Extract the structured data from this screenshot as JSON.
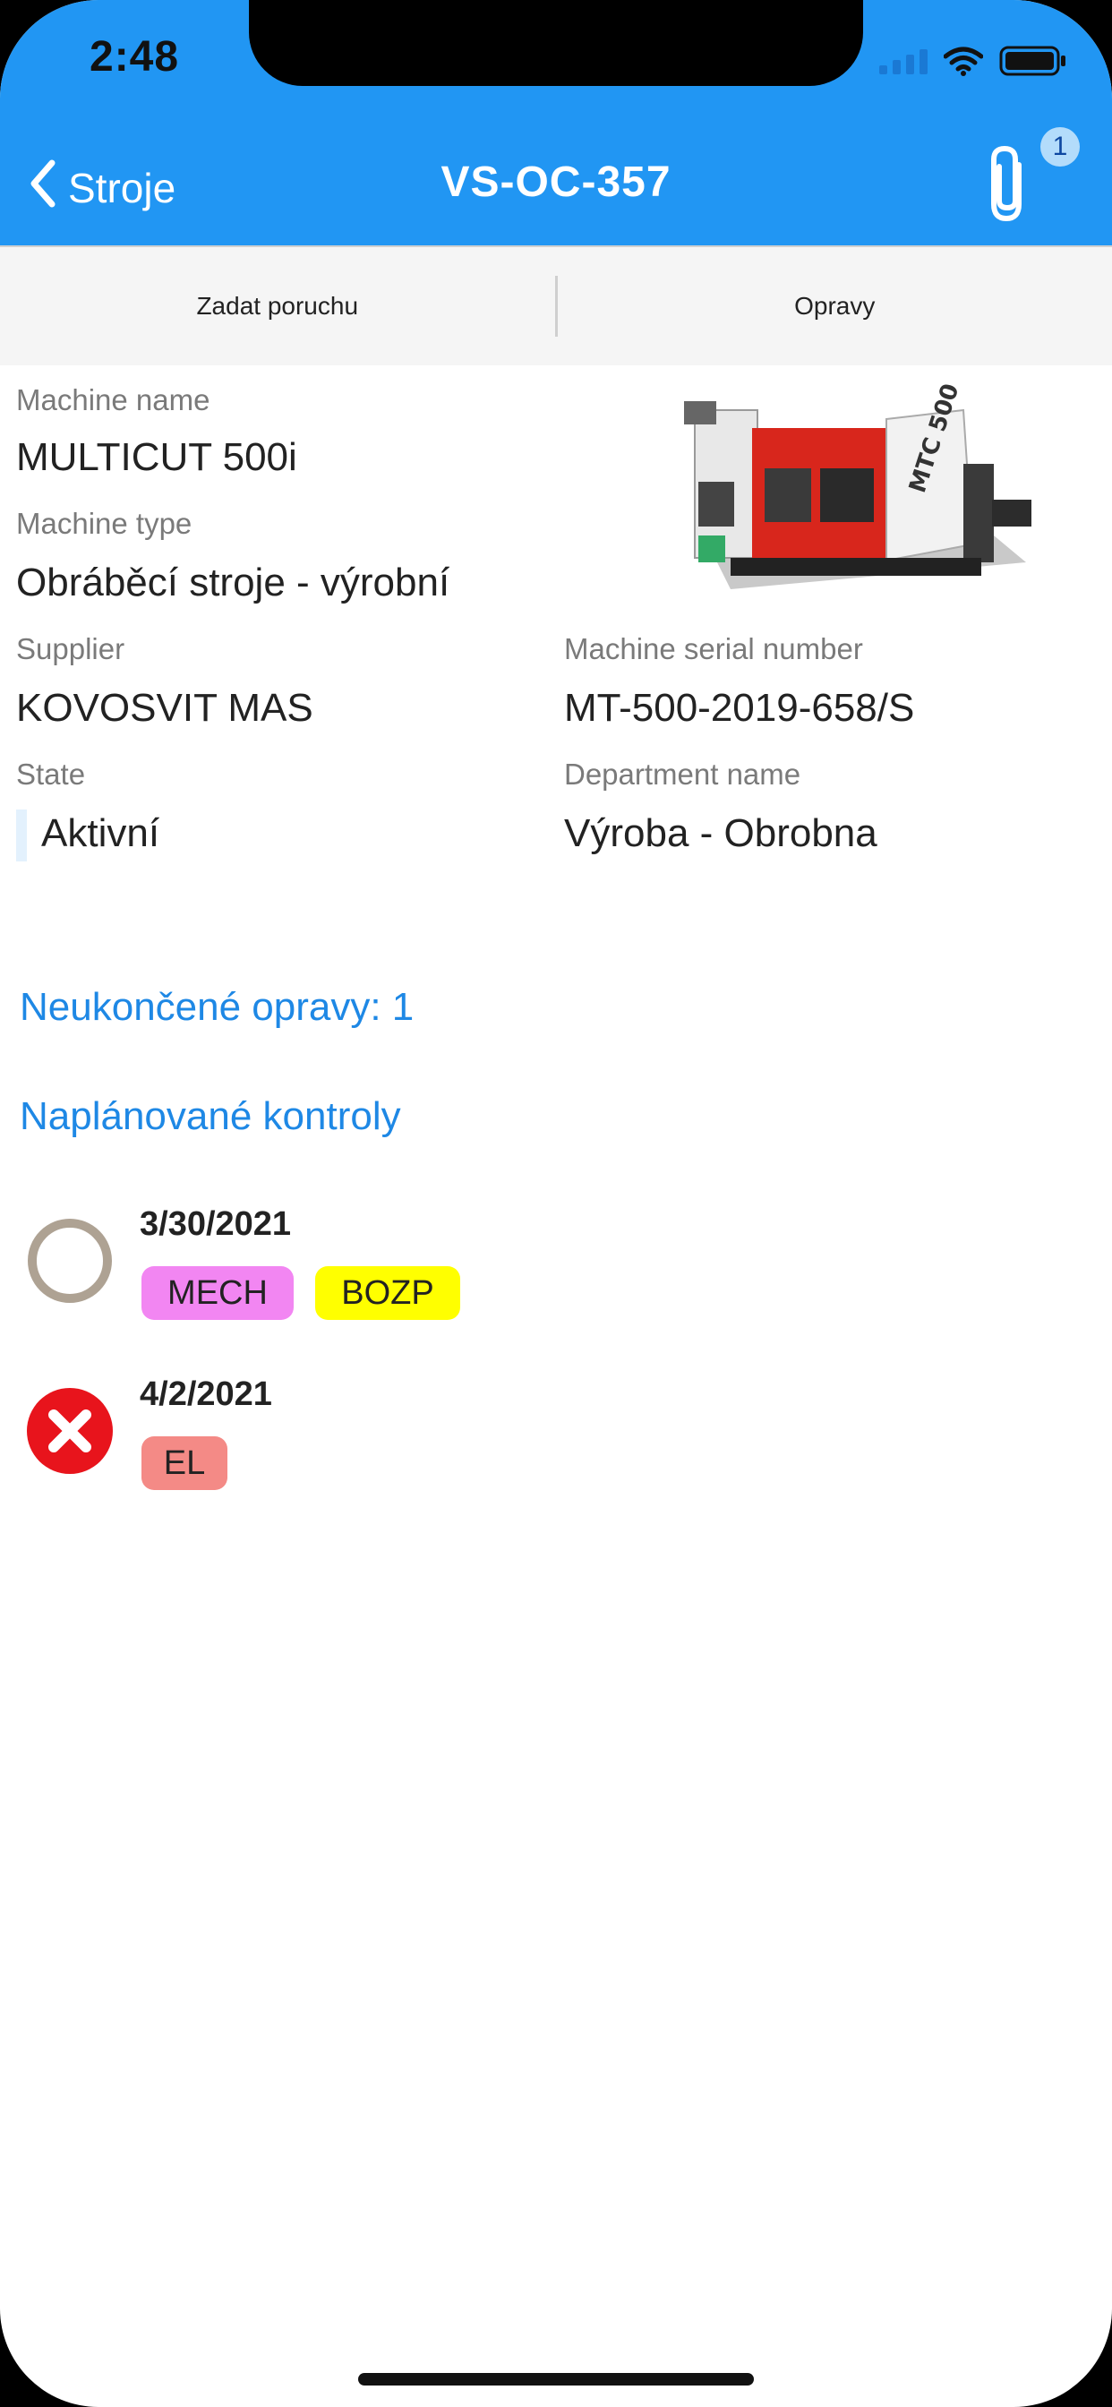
{
  "status": {
    "time": "2:48"
  },
  "nav": {
    "back_label": "Stroje",
    "title": "VS-OC-357",
    "attachment_badge": "1"
  },
  "tabs": [
    {
      "label": "Zadat poruchu"
    },
    {
      "label": "Opravy"
    }
  ],
  "machine": {
    "name_label": "Machine name",
    "name": "MULTICUT 500i",
    "type_label": "Machine type",
    "type": "Obráběcí stroje - výrobní",
    "supplier_label": "Supplier",
    "supplier": "KOVOSVIT MAS",
    "serial_label": "Machine serial number",
    "serial": "MT-500-2019-658/S",
    "state_label": "State",
    "state": "Aktivní",
    "department_label": "Department name",
    "department": "Výroba - Obrobna",
    "image_brand_text": "MTC 500"
  },
  "links": {
    "open_repairs": "Neukončené opravy: 1",
    "planned_checks": "Naplánované kontroly"
  },
  "controls": [
    {
      "date": "3/30/2021",
      "status_icon": "empty-circle-icon",
      "tags": [
        {
          "label": "MECH",
          "color": "#f286f2"
        },
        {
          "label": "BOZP",
          "color": "#ffff00"
        }
      ]
    },
    {
      "date": "4/2/2021",
      "status_icon": "error-x-circle-icon",
      "tags": [
        {
          "label": "EL",
          "color": "#f48a86"
        }
      ]
    }
  ],
  "colors": {
    "header": "#2196f3",
    "link": "#1e88e5",
    "error": "#e8141c",
    "pending_circle": "#aea293"
  }
}
